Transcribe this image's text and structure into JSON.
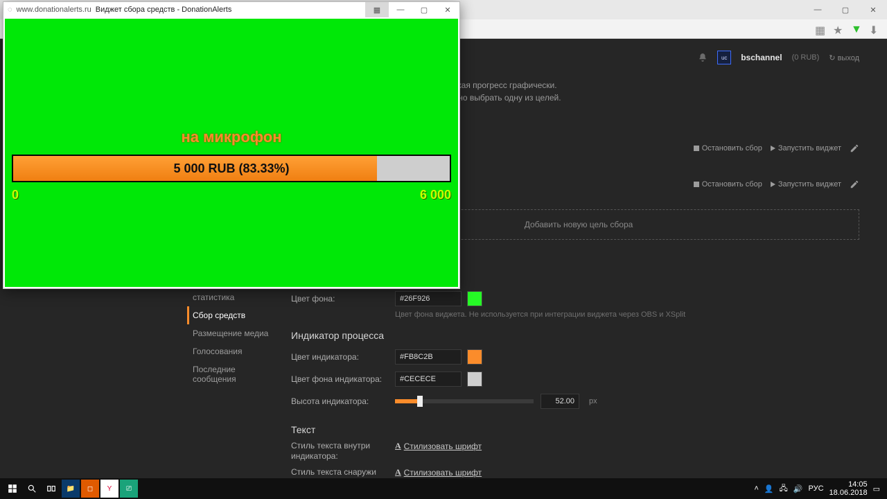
{
  "os": {
    "lang": "РУС",
    "time": "14:05",
    "date": "18.06.2018"
  },
  "browser_titlebar": {
    "min": "—",
    "max": "▢",
    "close": "✕"
  },
  "header": {
    "username": "bschannel",
    "balance": "(0 RUB)",
    "logout_icon": "↻",
    "logout": "выход"
  },
  "intro": {
    "line1": "средства на определённые цели, отображая прогресс графически.",
    "line2": "отправителю сообщений будет предложено выбрать одну из целей."
  },
  "sidebar": {
    "items": [
      {
        "label": "статистика"
      },
      {
        "label": "Сбор средств"
      },
      {
        "label": "Размещение медиа"
      },
      {
        "label": "Голосования"
      },
      {
        "label": "Последние сообщения"
      }
    ]
  },
  "goalActions": {
    "stop": "Остановить сбор",
    "run": "Запустить виджет"
  },
  "addGoal": "Добавить новую цель сбора",
  "settings": {
    "bgLabel": "Цвет фона:",
    "bgValue": "#26F926",
    "bgHint": "Цвет фона виджета. Не используется при интеграции виджета через OBS и XSplit",
    "indicatorTitle": "Индикатор процесса",
    "indColorLabel": "Цвет индикатора:",
    "indColorValue": "#FB8C2B",
    "indBgLabel": "Цвет фона индикатора:",
    "indBgValue": "#CECECE",
    "indHeightLabel": "Высота индикатора:",
    "indHeightValue": "52.00",
    "indHeightUnit": "px",
    "textTitle": "Текст",
    "textInnerLabel": "Стиль текста внутри индикатора:",
    "textOuterLabel": "Стиль текста снаружи",
    "stylize": "Стилизовать шрифт"
  },
  "popup": {
    "url": "www.donationalerts.ru",
    "title": "Виджет сбора средств - DonationAlerts",
    "goalTitle": "на микрофон",
    "barText": "5 000 RUB (83.33%)",
    "min": "0",
    "max": "6 000"
  }
}
